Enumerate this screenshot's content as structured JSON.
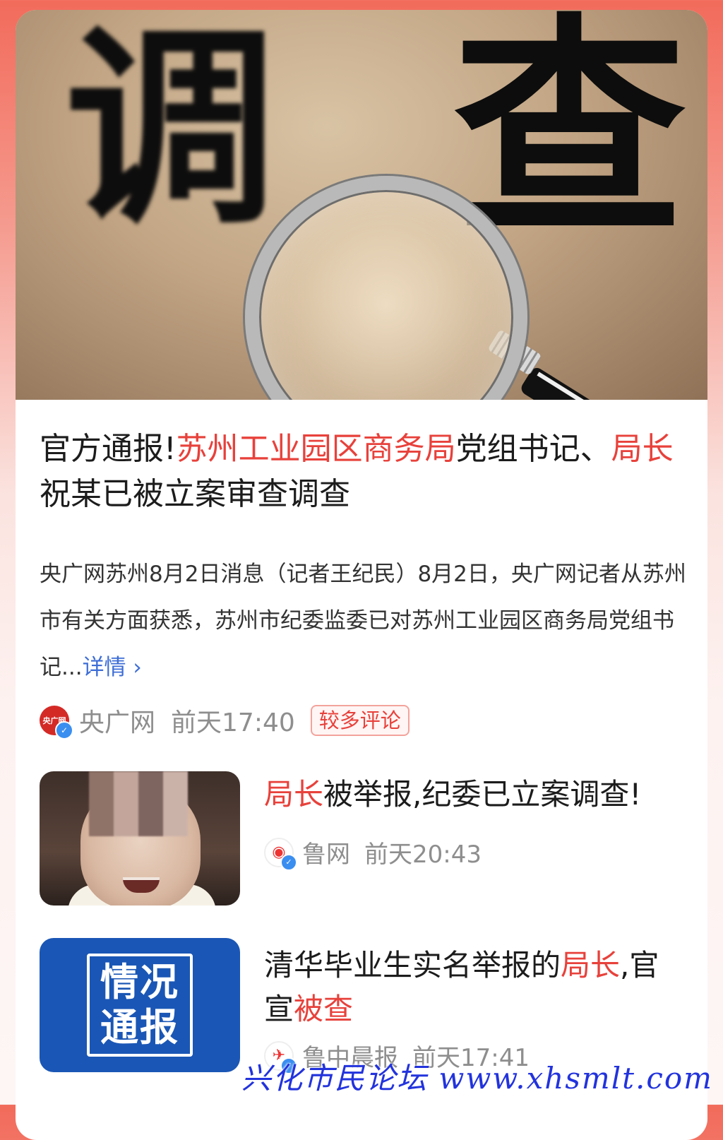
{
  "hero": {
    "char1": "调",
    "char2": "查"
  },
  "main_article": {
    "headline_parts": [
      {
        "text": "官方通报!",
        "highlight": false
      },
      {
        "text": "苏州工业园区商务局",
        "highlight": true
      },
      {
        "text": "党组书记、",
        "highlight": false
      },
      {
        "text": "局长",
        "highlight": true
      },
      {
        "text": "祝某已被立案审查调查",
        "highlight": false
      }
    ],
    "summary": "央广网苏州8月2日消息（记者王纪民）8月2日，央广网记者从苏州市有关方面获悉，苏州市纪委监委已对苏州工业园区商务局党组书记...",
    "more_label": "详情",
    "more_icon": "chevron-right-icon",
    "source_logo_text": "央广网",
    "source": "央广网",
    "time": "前天17:40",
    "badge": "较多评论"
  },
  "items": [
    {
      "title_parts": [
        {
          "text": "局长",
          "highlight": true
        },
        {
          "text": "被举报,纪委已立案调查!",
          "highlight": false
        }
      ],
      "source": "鲁网",
      "time": "前天20:43"
    },
    {
      "title_parts": [
        {
          "text": "清华毕业生实名举报的",
          "highlight": false
        },
        {
          "text": "局长",
          "highlight": true
        },
        {
          "text": ",官宣",
          "highlight": false
        },
        {
          "text": "被查",
          "highlight": true
        }
      ],
      "thumb_text_line1": "情况",
      "thumb_text_line2": "通报",
      "source": "鲁中晨报",
      "time": "前天17:41"
    }
  ],
  "watermark": "兴化市民论坛 www.xhsmlt.com",
  "colors": {
    "highlight": "#e8413b",
    "link": "#3d6dd6",
    "verified": "#3a8ef0"
  }
}
